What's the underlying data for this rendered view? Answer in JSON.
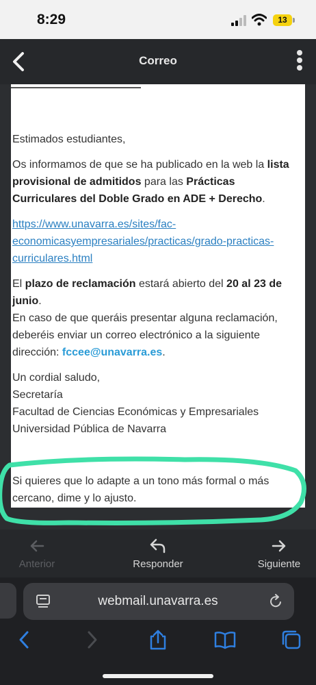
{
  "status_bar": {
    "time": "8:29",
    "battery": "13"
  },
  "header": {
    "title": "Correo"
  },
  "email": {
    "greeting": "Estimados estudiantes,",
    "p1_a": "Os informamos de que se ha publicado en la web la ",
    "p1_b": "lista provisional de admitidos",
    "p1_c": " para las ",
    "p1_d": "Prácticas Curriculares del Doble Grado en ADE + Derecho",
    "p1_e": ".",
    "link": "https://www.unavarra.es/sites/fac-economicasyempresariales/practicas/grado-practicas-curriculares.html",
    "p2_a": "El ",
    "p2_b": "plazo de reclamación",
    "p2_c": " estará abierto del ",
    "p2_d": "20 al 23 de junio",
    "p2_e": ".",
    "p3_a": "En caso de que queráis presentar alguna reclamación, deberéis enviar un correo electrónico a la siguiente dirección: ",
    "p3_email": "fccee@unavarra.es",
    "p3_b": ".",
    "closing": "Un cordial saludo,",
    "sig1": "Secretaría",
    "sig2": "Facultad de Ciencias Económicas y Empresariales",
    "sig3": "Universidad Pública de Navarra"
  },
  "addendum": "Si quieres que lo adapte a un tono más formal o más cercano, dime y lo ajusto.",
  "toolbar": {
    "prev": "Anterior",
    "reply": "Responder",
    "next": "Siguiente"
  },
  "browser": {
    "url": "webmail.unavarra.es"
  },
  "colors": {
    "highlight": "#3fe0a8",
    "link": "#2a7fc1",
    "email_link": "#2a9bd6",
    "safari_blue": "#2f7fe0"
  }
}
